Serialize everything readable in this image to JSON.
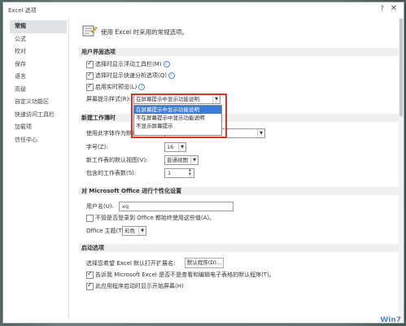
{
  "window": {
    "title": "Excel 选项"
  },
  "sidebar": {
    "items": [
      {
        "label": "常规",
        "active": true
      },
      {
        "label": "公式"
      },
      {
        "label": "校对"
      },
      {
        "label": "保存"
      },
      {
        "label": "语言"
      },
      {
        "label": "高级"
      },
      {
        "label": "自定义功能区"
      },
      {
        "label": "快速访问工具栏"
      },
      {
        "label": "加载项"
      },
      {
        "label": "信任中心"
      }
    ]
  },
  "header": {
    "text": "使用 Excel 时采用的常规选项。"
  },
  "ui_section": {
    "title": "用户界面选项",
    "cb1": "选择时显示浮动工具栏(M)",
    "cb2": "选择时显示快速分析选项(Q)",
    "cb3": "启用实时预览(L)",
    "screentip_label": "屏幕提示样式(R):",
    "screentip_value": "在屏幕提示中显示功能说明",
    "dropdown_options": [
      "在屏幕提示中显示功能说明",
      "不在屏幕提示中显示功能说明",
      "不显示屏幕提示"
    ]
  },
  "new_wb_section": {
    "title": "新建工作簿时",
    "font_label": "使用此字体作为默认字体(N):",
    "font_value": "",
    "size_label": "字号(Z):",
    "size_value": "16",
    "view_label": "新工作表的默认视图(V):",
    "view_value": "普通视图",
    "sheets_label": "包含的工作表数(S):",
    "sheets_value": "1"
  },
  "personalize_section": {
    "title": "对 Microsoft Office 进行个性化设置",
    "username_label": "用户名(U):",
    "username_value": "xq",
    "cb_always": "不管是否登录到 Office 都始终使用这些值(A)。",
    "theme_label": "Office 主题(T):",
    "theme_value": "彩色"
  },
  "startup_section": {
    "title": "启动选项",
    "ext_label": "选择您希望 Excel 默认打开扩展名:",
    "default_programs_btn": "默认程序(D)...",
    "cb_default": "告诉我 Microsoft Excel 是否不是查看和编辑电子表格的默认程序(T)。",
    "cb_startup": "此应用程序启动时显示开始屏幕(H)"
  },
  "checked": {
    "cb1": true,
    "cb2": true,
    "cb3": true,
    "always": false,
    "default": true,
    "startup": true
  },
  "colors": {
    "highlight": "#3b7cd6",
    "callout": "#d9342b"
  },
  "watermark": "Win7"
}
